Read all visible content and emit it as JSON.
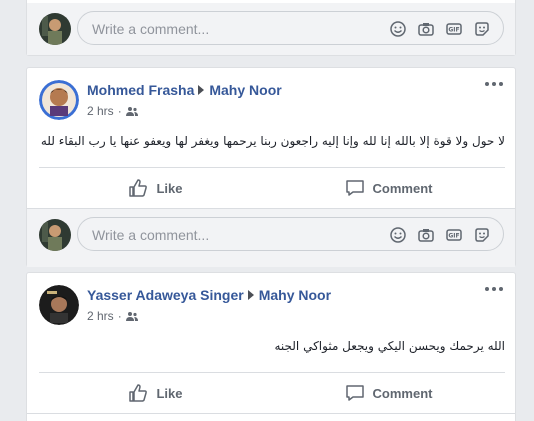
{
  "comment_box": {
    "placeholder": "Write a comment..."
  },
  "posts": [
    {
      "author": "Mohmed Frasha",
      "target": "Mahy Noor",
      "time": "2 hrs",
      "text": "لا حول ولا قوة إلا بالله إنا لله وإنا إليه راجعون ربنا يرحمها ويغفر لها ويعفو عنها يا رب البقاء لله",
      "like_label": "Like",
      "comment_label": "Comment"
    },
    {
      "author": "Yasser Adaweya Singer",
      "target": "Mahy Noor",
      "time": "2 hrs",
      "text": "الله يرحمك ويحسن اليكي ويجعل مثواكي الجنه",
      "like_label": "Like",
      "comment_label": "Comment"
    }
  ],
  "icons": {
    "emoji": "emoji-icon",
    "camera": "camera-icon",
    "gif": "gif-icon",
    "sticker": "sticker-icon",
    "audience": "friends-icon",
    "more": "more-options-icon",
    "like": "thumbs-up-icon",
    "comment": "comment-bubble-icon"
  },
  "colors": {
    "link": "#365899",
    "meta": "#616770",
    "background": "#e9ebee"
  }
}
